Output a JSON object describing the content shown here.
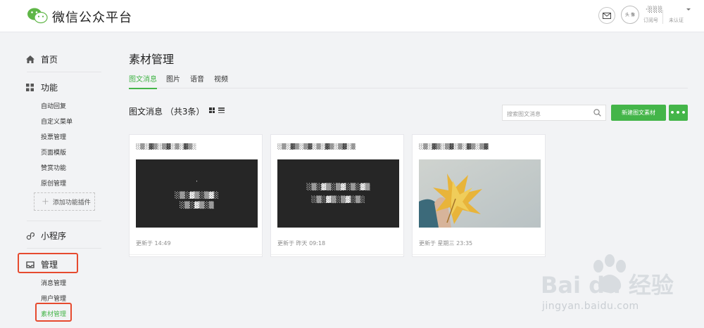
{
  "header": {
    "title": "微信公众平台",
    "account_name": "·░░░",
    "account_type": "订阅号",
    "account_status": "未认证",
    "avatar_text": "头 像"
  },
  "sidebar": {
    "home": "首页",
    "features": {
      "label": "功能",
      "items": [
        "自动回复",
        "自定义菜单",
        "投票管理",
        "页面模版",
        "赞赏功能",
        "原创管理"
      ],
      "add_plugin": "添加功能插件"
    },
    "mini_program": "小程序",
    "manage": {
      "label": "管理",
      "items": [
        "消息管理",
        "用户管理",
        "素材管理"
      ]
    }
  },
  "main": {
    "title": "素材管理",
    "tabs": [
      {
        "label": "图文消息",
        "active": true
      },
      {
        "label": "图片",
        "active": false
      },
      {
        "label": "语音",
        "active": false
      },
      {
        "label": "视频",
        "active": false
      }
    ],
    "section_title": "图文消息 （共3条）",
    "search_placeholder": "搜索图文消息",
    "new_button": "新建图文素材",
    "more_button": "•••"
  },
  "cards": [
    {
      "title": "░▒░▓▒░▒▓░▒░▓▒░",
      "cover_lines": [
        "·",
        "░▒░▓▒░▒▓░",
        "░▒░▓▒░▒"
      ],
      "updated": "更新于 14:49"
    },
    {
      "title": "░▒░▓▒░▒▓░▒░▓▒░▒▓░▒",
      "cover_lines": [
        "░▒░▓▒░▒▓░▒░▓▒",
        "░▒░▓▒░▒▓░▒░"
      ],
      "updated": "更新于 昨天 09:18"
    },
    {
      "title": "░▒░▓▒░▒▓░▒░▓▒░▒▓",
      "cover_lines": [],
      "updated": "更新于 星期三 23:35"
    }
  ],
  "watermark": {
    "logo": "Bai du 经验",
    "url": "jingyan.baidu.com"
  },
  "colors": {
    "accent": "#44b549",
    "highlight": "#e64a2e",
    "background": "#f2f3f5"
  },
  "icons": {
    "mail": "mail-icon",
    "home": "home-icon",
    "features": "grid-icon",
    "mini_program": "link-icon",
    "manage": "inbox-icon",
    "search": "search-icon"
  }
}
